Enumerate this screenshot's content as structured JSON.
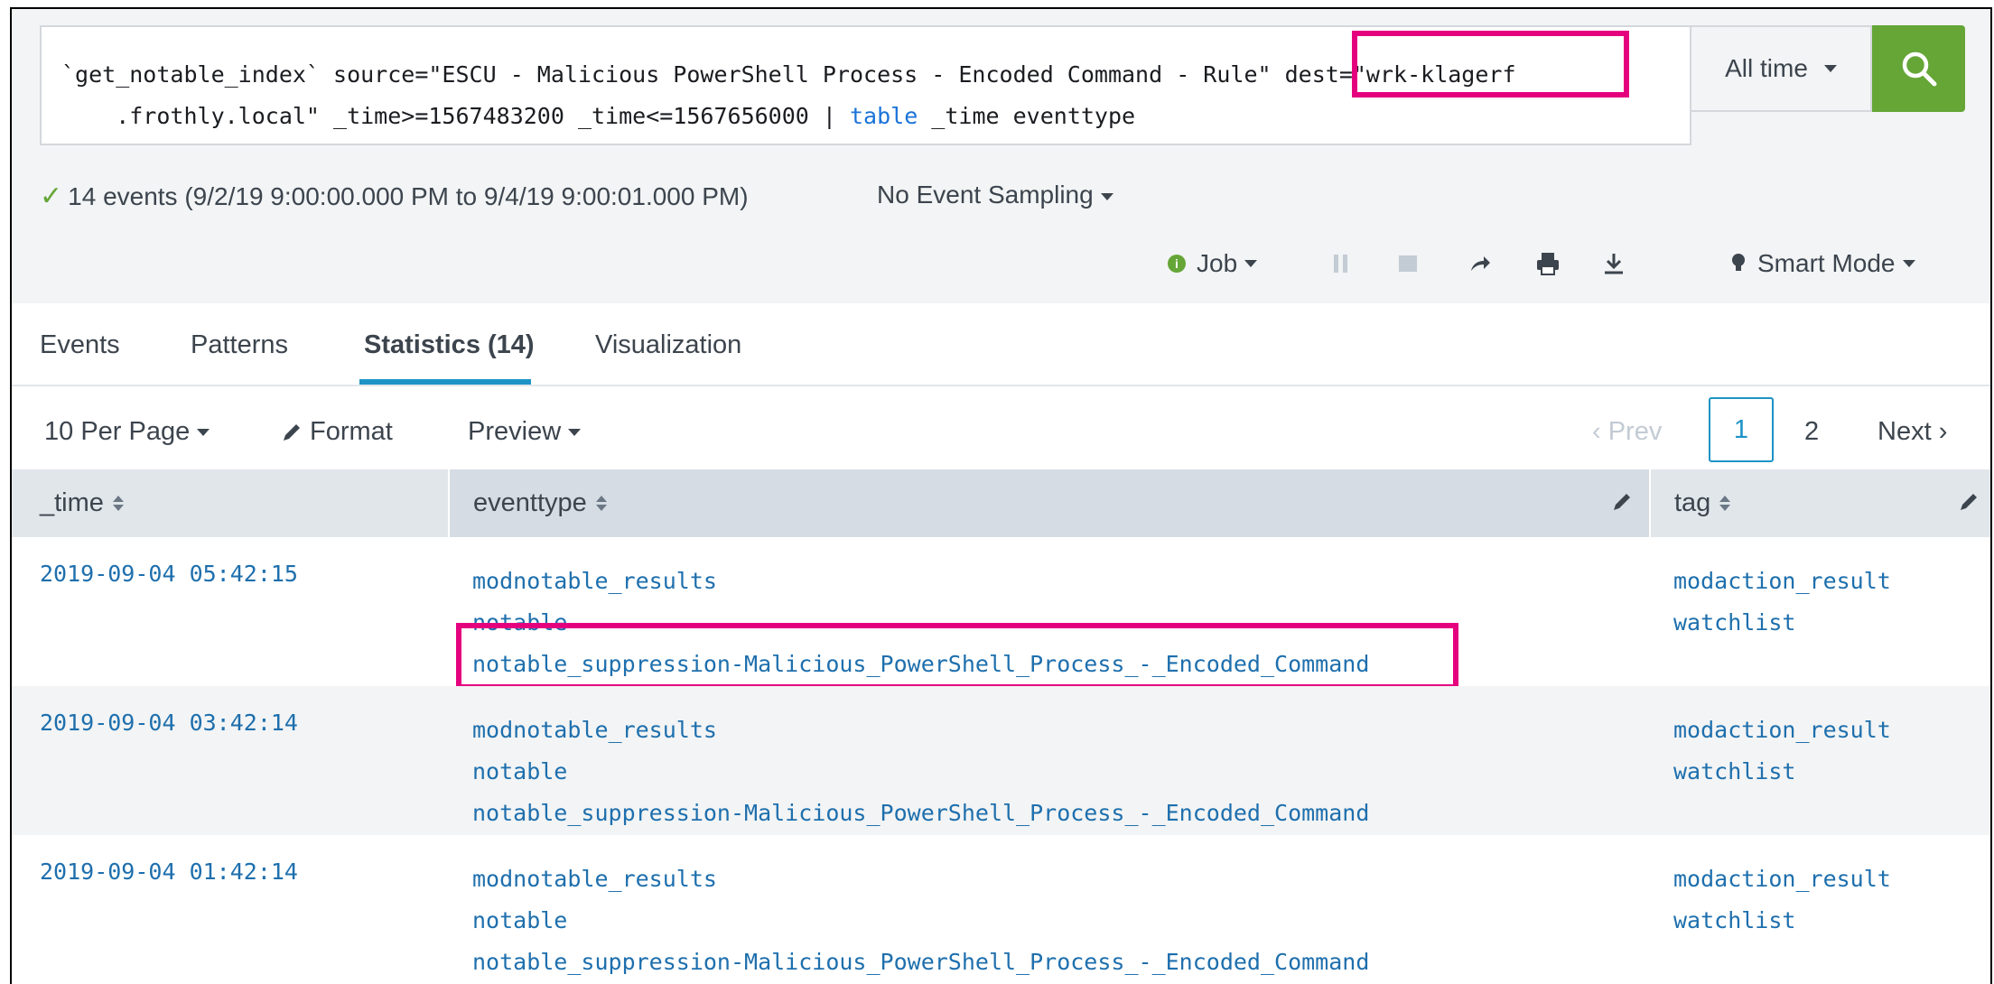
{
  "search": {
    "line1_part1": "`get_notable_index` source=\"ESCU - Malicious PowerShell Process - Encoded Command - Rule\" ",
    "line1_part2": "dest=\"wrk-klagerf",
    "line2_part1": "    .frothly.local\" _time>=1567483200 _time<=1567656000 | ",
    "line2_keyword": "table",
    "line2_part2": " _time eventtype",
    "time_range": "All time"
  },
  "status": {
    "summary": "14 events (9/2/19 9:00:00.000 PM to 9/4/19 9:00:01.000 PM)",
    "sampling": "No Event Sampling",
    "job_label": "Job",
    "mode": "Smart Mode"
  },
  "tabs": [
    {
      "label": "Events"
    },
    {
      "label": "Patterns"
    },
    {
      "label": "Statistics (14)"
    },
    {
      "label": "Visualization"
    }
  ],
  "controls": {
    "per_page": "10 Per Page",
    "format": "Format",
    "preview": "Preview",
    "prev": "Prev",
    "page_current": "1",
    "page_next_num": "2",
    "next": "Next"
  },
  "table": {
    "columns": [
      "_time",
      "eventtype",
      "tag"
    ],
    "rows": [
      {
        "time": "2019-09-04 05:42:15",
        "eventtype": [
          "modnotable_results",
          "notable",
          "notable_suppression-Malicious_PowerShell_Process_-_Encoded_Command"
        ],
        "tag": [
          "modaction_result",
          "watchlist"
        ]
      },
      {
        "time": "2019-09-04 03:42:14",
        "eventtype": [
          "modnotable_results",
          "notable",
          "notable_suppression-Malicious_PowerShell_Process_-_Encoded_Command"
        ],
        "tag": [
          "modaction_result",
          "watchlist"
        ]
      },
      {
        "time": "2019-09-04 01:42:14",
        "eventtype": [
          "modnotable_results",
          "notable",
          "notable_suppression-Malicious_PowerShell_Process_-_Encoded_Command"
        ],
        "tag": [
          "modaction_result",
          "watchlist"
        ]
      }
    ]
  },
  "colors": {
    "accent": "#1e93c6",
    "search_button": "#65a637",
    "highlight": "#e5007e",
    "link": "#1e6fad"
  }
}
